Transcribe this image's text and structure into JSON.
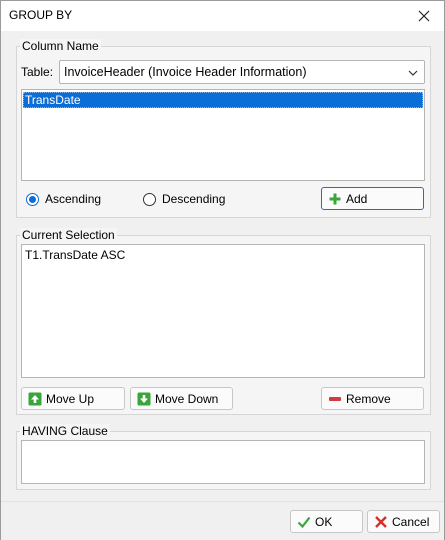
{
  "dialog": {
    "title": "GROUP BY",
    "close_icon": "close-icon"
  },
  "column_name": {
    "group_label": "Column Name",
    "table_label": "Table:",
    "table_value": "InvoiceHeader  (Invoice Header Information)",
    "columns": [
      "TransDate"
    ],
    "selected_column": "TransDate",
    "sort_options": [
      "Ascending",
      "Descending"
    ],
    "sort_selected": "Ascending",
    "add_label": "Add",
    "add_icon": "plus-icon"
  },
  "current_selection": {
    "group_label": "Current Selection",
    "items": [
      "T1.TransDate ASC"
    ],
    "move_up_label": "Move Up",
    "move_up_icon": "arrow-up-icon",
    "move_down_label": "Move Down",
    "move_down_icon": "arrow-down-icon",
    "remove_label": "Remove",
    "remove_icon": "minus-icon"
  },
  "having": {
    "group_label": "HAVING Clause",
    "value": ""
  },
  "footer": {
    "ok_label": "OK",
    "ok_icon": "check-icon",
    "cancel_label": "Cancel",
    "cancel_icon": "x-icon"
  },
  "colors": {
    "accent": "#0b6dd6",
    "green_icon": "#3aa53a",
    "remove_red": "#d23c3c",
    "cancel_red": "#d0312d"
  }
}
